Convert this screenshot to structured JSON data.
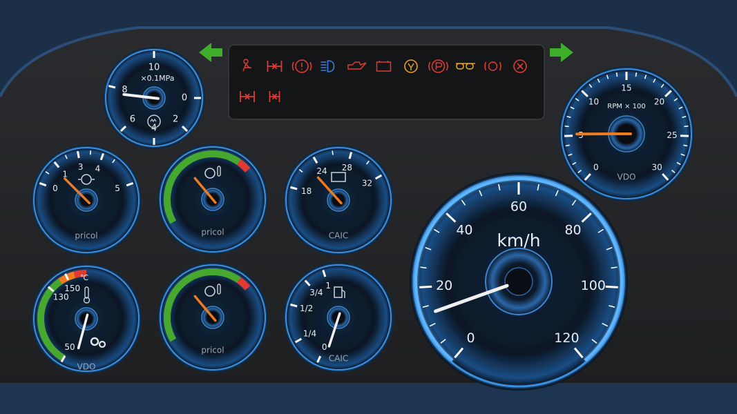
{
  "colors": {
    "background": "#232426",
    "bezel": "#1e3552",
    "ring": "#3a8fe0",
    "needle_orange": "#f07a1e",
    "needle_white": "#f0f0f0",
    "warning_red": "#e23a32",
    "warning_amber": "#e8a020",
    "arrow_green": "#3fae2a",
    "arc_green": "#47a82f",
    "arc_orange": "#f07a1e",
    "arc_red": "#e23a32"
  },
  "turn_signals": {
    "left": "turn-left-arrow",
    "right": "turn-right-arrow"
  },
  "warning_lights": [
    {
      "name": "seatbelt-icon",
      "color": "red"
    },
    {
      "name": "axle-lock-icon",
      "color": "red"
    },
    {
      "name": "brake-warning-icon",
      "color": "red"
    },
    {
      "name": "high-beam-icon",
      "color": "red"
    },
    {
      "name": "oil-can-icon",
      "color": "red"
    },
    {
      "name": "battery-icon",
      "color": "red"
    },
    {
      "name": "air-filter-icon",
      "color": "amber"
    },
    {
      "name": "parking-brake-icon",
      "color": "red"
    },
    {
      "name": "glow-plug-icon",
      "color": "amber"
    },
    {
      "name": "brake-pad-icon",
      "color": "red"
    },
    {
      "name": "stop-icon",
      "color": "red"
    },
    {
      "name": "differential-lock-icon",
      "color": "red"
    },
    {
      "name": "axle-icon",
      "color": "red"
    }
  ],
  "gauges": {
    "air_pressure": {
      "unit": "×0.1MPa",
      "ticks": [
        "2",
        "4",
        "6",
        "8",
        "10",
        "0"
      ],
      "value": 8.1
    },
    "tachometer": {
      "unit": "RPM × 100",
      "ticks": [
        "0",
        "5",
        "10",
        "15",
        "20",
        "25",
        "30"
      ],
      "brand": "VDO",
      "value": 5.2
    },
    "oil_pressure": {
      "ticks": [
        "0",
        "1",
        "3",
        "4",
        "5"
      ],
      "brand": "pricol",
      "value": 1.0
    },
    "oil_temp_1": {
      "brand": "pricol",
      "value_fraction": 0.36
    },
    "voltage": {
      "ticks": [
        "18",
        "24",
        "28",
        "32"
      ],
      "brand": "CAIC",
      "value": 22
    },
    "coolant_temp": {
      "unit": "℃",
      "ticks": [
        "50",
        "130",
        "150"
      ],
      "brand": "VDO",
      "value": 60
    },
    "oil_temp_2": {
      "brand": "pricol",
      "value_fraction": 0.36
    },
    "fuel": {
      "ticks": [
        "0",
        "1/4",
        "1/2",
        "3/4",
        "1"
      ],
      "brand": "CAIC",
      "value_fraction": 0.1
    },
    "speedometer": {
      "unit": "km/h",
      "ticks": [
        "0",
        "20",
        "40",
        "60",
        "80",
        "100",
        "120"
      ],
      "value": 13
    }
  }
}
